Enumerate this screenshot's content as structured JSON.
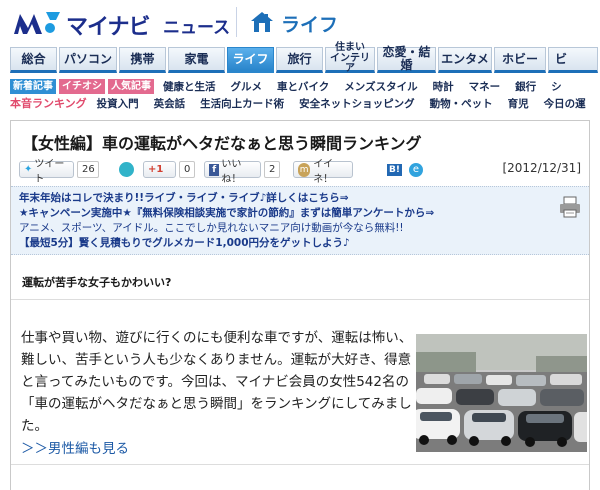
{
  "header": {
    "logo_text": "マイナビ",
    "logo_news": "ニュース",
    "section_title": "ライフ"
  },
  "main_nav": [
    {
      "label": "総合"
    },
    {
      "label": "パソコン"
    },
    {
      "label": "携帯"
    },
    {
      "label": "家電"
    },
    {
      "label": "ライフ",
      "active": true
    },
    {
      "label": "旅行"
    },
    {
      "label": "住まい\nインテリア"
    },
    {
      "label": "恋愛・結婚"
    },
    {
      "label": "エンタメ"
    },
    {
      "label": "ホビー"
    },
    {
      "label": "ビ"
    }
  ],
  "sub_nav": {
    "badges": [
      "新着記事",
      "イチオシ",
      "人気記事"
    ],
    "row1_links": [
      "健康と生活",
      "グルメ",
      "車とバイク",
      "メンズスタイル",
      "時計",
      "マネー",
      "銀行",
      "シ"
    ],
    "rank_label": "本音ランキング",
    "row2_links": [
      "投資入門",
      "英会話",
      "生活向上カード術",
      "安全ネットショッピング",
      "動物・ペット",
      "育児",
      "今日の運"
    ]
  },
  "article": {
    "title": "【女性編】車の運転がヘタだなぁと思う瞬間ランキング",
    "date": "[2012/12/31]",
    "social": {
      "tweet_label": "ツイート",
      "tweet_count": "26",
      "gplus_label": "+1",
      "gplus_count": "0",
      "like_label": "いいね！",
      "like_count": "2",
      "iine_label": "イイネ！",
      "hatena_label": "B!",
      "e_label": "e"
    },
    "promo": [
      "年末年始はコレで決まり!!ライブ・ライブ・ライブ♪詳しくはこちら⇒",
      "★キャンペーン実施中★『無料保険相談実施で家計の節約』まずは簡単アンケートから⇒",
      "アニメ、スポーツ、アイドル。ここでしか見れないマニア向け動画が今なら無料!!",
      "【最短5分】賢く見積もりでグルメカード1,000円分をゲットしよう♪"
    ],
    "lead": "運転が苦手な女子もかわいい?",
    "body": "仕事や買い物、遊びに行くのにも便利な車ですが、運転は怖い、難しい、苦手という人も少なくありません。運転が大好き、得意と言ってみたいものです。今回は、マイナビ会員の女性542名の「車の運転がヘタだなぁと思う瞬間」をランキングにしてみました。",
    "more_link": "＞＞男性編も見る"
  },
  "colors": {
    "brand_navy": "#1c2e8c",
    "accent_blue": "#1d6fb8",
    "active_tab": "#2a86cc",
    "pink_badge": "#e36a8f",
    "promo_bg": "#eaf2fa",
    "link": "#1d5aa6"
  },
  "icons": {
    "logo": "mynavi-n-logo-icon",
    "section": "house-icon",
    "print": "printer-icon",
    "photo": "parking-lot-photo"
  }
}
